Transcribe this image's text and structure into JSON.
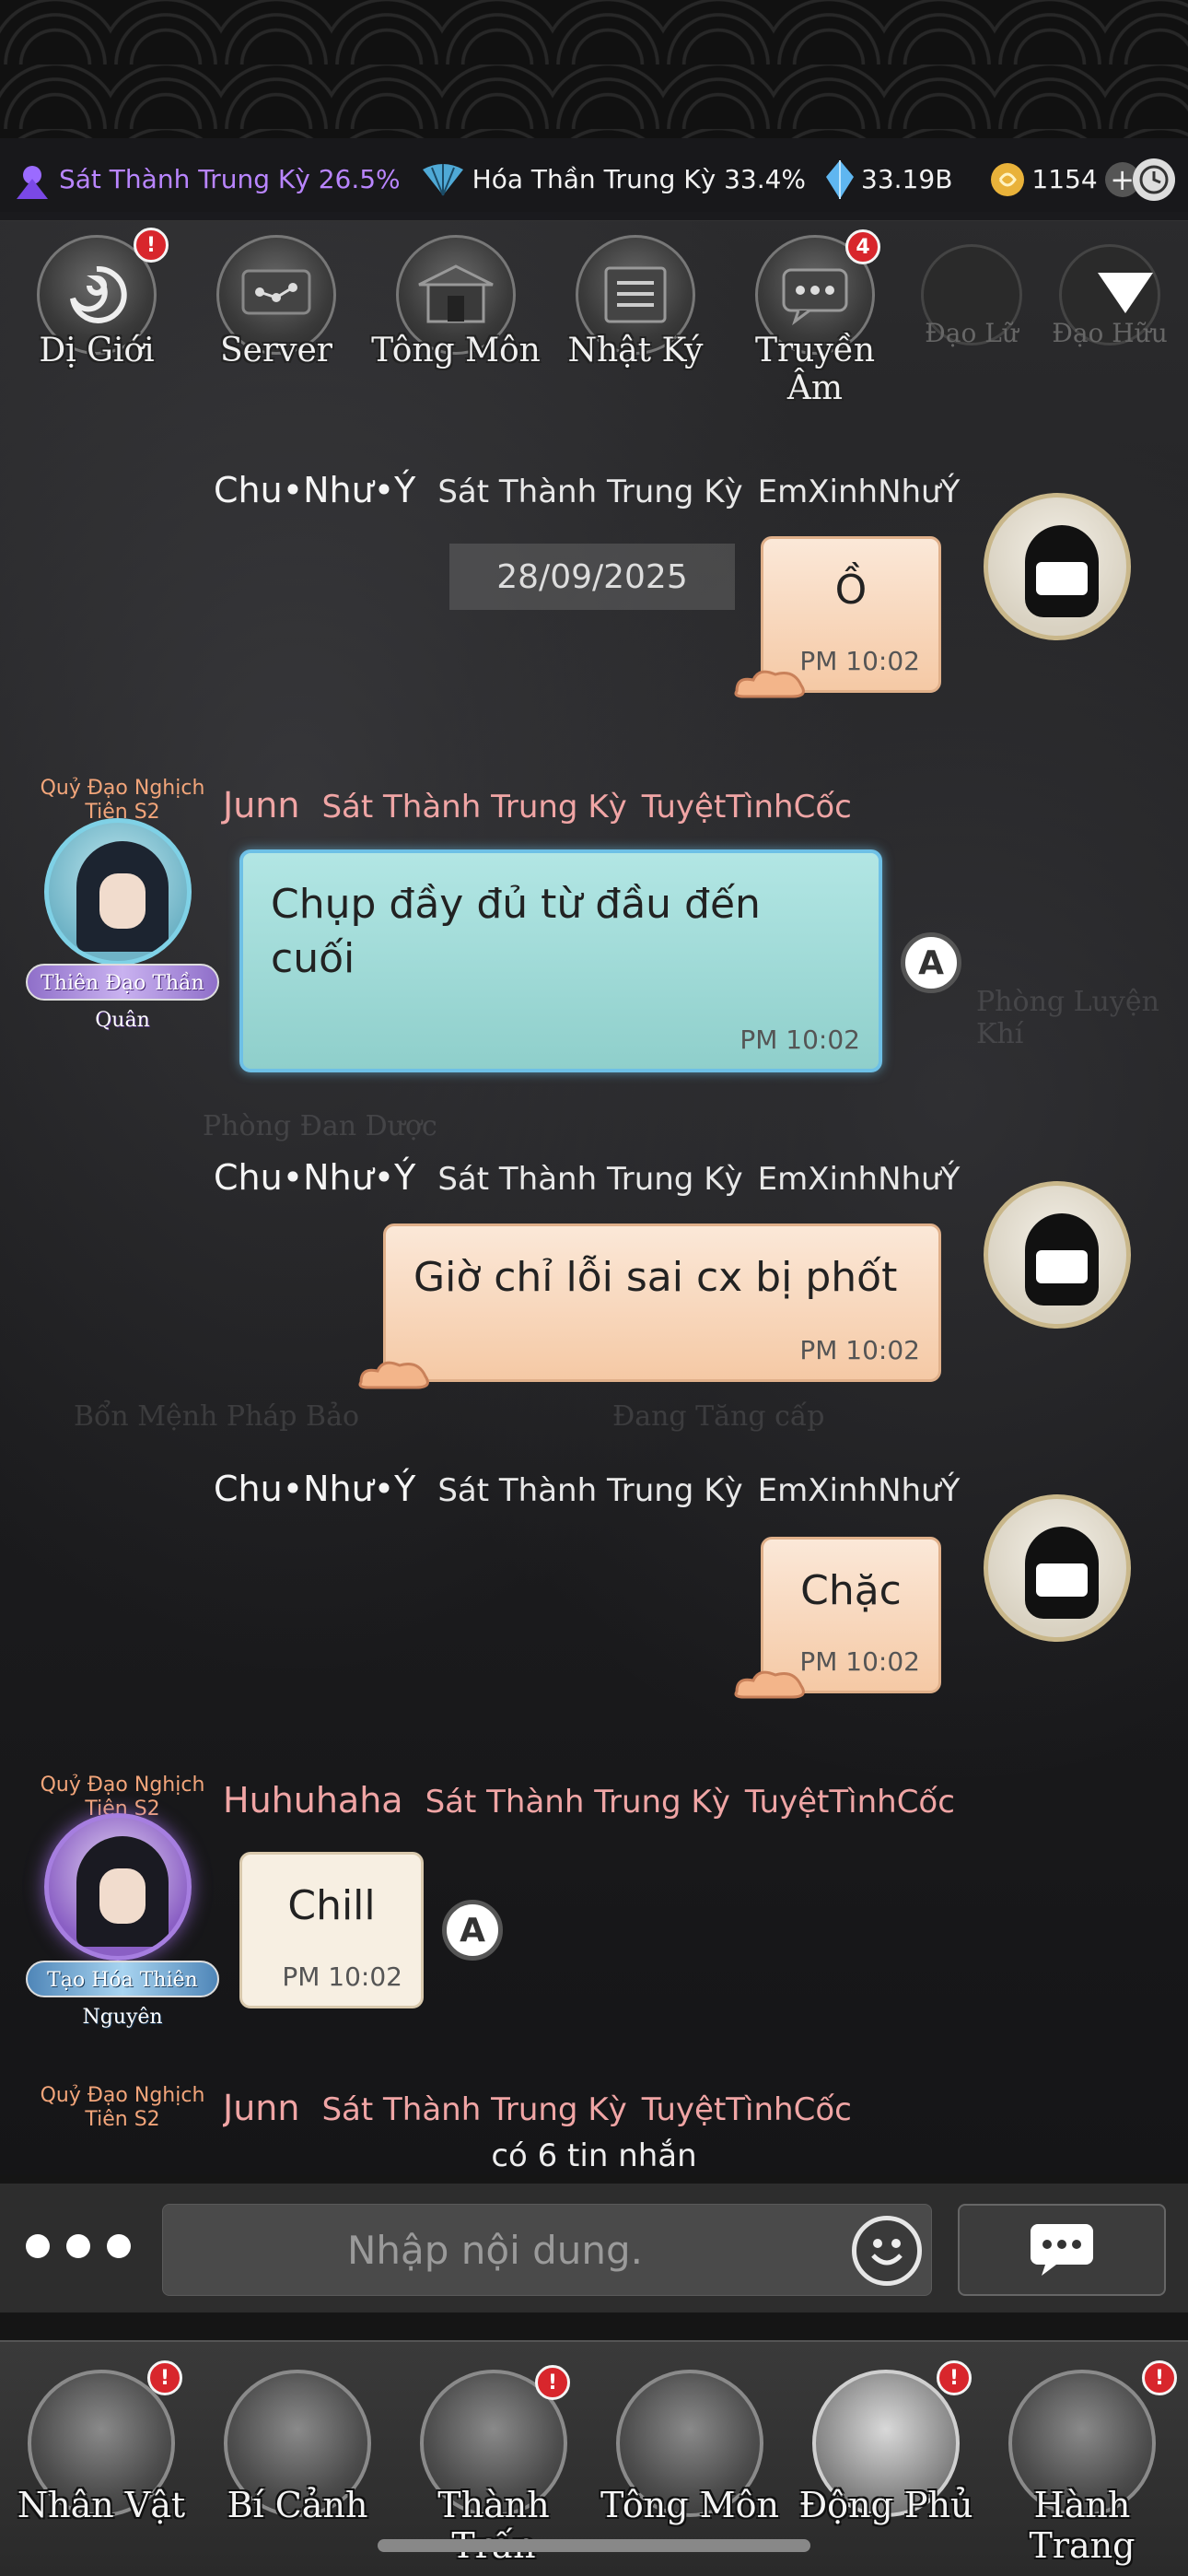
{
  "status_bar": {
    "realm1": "Sát Thành Trung Kỳ 26.5%",
    "realm2": "Hóa Thần Trung Kỳ 33.4%",
    "crystal": "33.19B",
    "coin": "1154",
    "plus": "+"
  },
  "tabs": [
    {
      "label": "Dị Giới",
      "icon": "swirl-icon",
      "badge": "!"
    },
    {
      "label": "Server",
      "icon": "chat-network-icon",
      "badge": ""
    },
    {
      "label": "Tông Môn",
      "icon": "temple-icon",
      "badge": ""
    },
    {
      "label": "Nhật Ký",
      "icon": "journal-icon",
      "badge": ""
    },
    {
      "label": "Truyền Âm",
      "icon": "message-icon",
      "badge": "4"
    },
    {
      "label": "Đạo Lữ",
      "icon": "companion-icon",
      "badge": ""
    },
    {
      "label": "Đạo Hữu",
      "icon": "friend-icon",
      "badge": ""
    }
  ],
  "background_labels": {
    "phong_luyen_khi": "Phòng Luyện Khí",
    "phong_dan_duoc": "Phòng Đan Dược",
    "ban_menh_phap_bao": "Bổn Mệnh Pháp Bảo",
    "dang_tang_cap": "Đang Tăng cấp"
  },
  "date": "28/09/2025",
  "messages": [
    {
      "name": "Chu•Như•Ý",
      "realm": "Sát Thành Trung Kỳ",
      "sect": "EmXinhNhưÝ",
      "text": "Ồ",
      "time": "PM 10:02"
    },
    {
      "name": "Junn",
      "realm": "Sát Thành Trung Kỳ",
      "sect": "TuyệtTìnhCốc",
      "text": "Chụp đầy đủ từ đầu đến cuối",
      "time": "PM 10:02",
      "rank_top": "Quỷ Đạo Nghịch Tiên S2",
      "rank_bottom": "Thiên Đạo Thần Quân"
    },
    {
      "name": "Chu•Như•Ý",
      "realm": "Sát Thành Trung Kỳ",
      "sect": "EmXinhNhưÝ",
      "text": "Giờ chỉ lỗi sai cx bị phốt",
      "time": "PM 10:02"
    },
    {
      "name": "Chu•Như•Ý",
      "realm": "Sát Thành Trung Kỳ",
      "sect": "EmXinhNhưÝ",
      "text": "Chặc",
      "time": "PM 10:02"
    },
    {
      "name": "Huhuhaha",
      "realm": "Sát Thành Trung Kỳ",
      "sect": "TuyệtTìnhCốc",
      "text": "Chill",
      "time": "PM 10:02",
      "rank_top": "Quỷ Đạo Nghịch Tiên S2",
      "rank_bottom": "Tạo Hóa Thiên Nguyên"
    },
    {
      "name": "Junn",
      "realm": "Sát Thành Trung Kỳ",
      "sect": "TuyệtTìnhCốc",
      "rank_top": "Quỷ Đạo Nghịch Tiên S2"
    }
  ],
  "new_message_count": "có 6 tin nhắn",
  "input": {
    "placeholder": "Nhập nội dung."
  },
  "a_icon_letter": "A",
  "bottom_nav": [
    {
      "label": "Nhân Vật",
      "icon": "hat-icon",
      "badge": "!"
    },
    {
      "label": "Bí Cảnh",
      "icon": "swirl-icon",
      "badge": ""
    },
    {
      "label": "Thành Trấn",
      "icon": "town-icon",
      "badge": "!"
    },
    {
      "label": "Tông Môn",
      "icon": "dragon-icon",
      "badge": ""
    },
    {
      "label": "Động Phủ",
      "icon": "cave-icon",
      "badge": "!"
    },
    {
      "label": "Hành Trang",
      "icon": "bag-icon",
      "badge": "!"
    }
  ]
}
